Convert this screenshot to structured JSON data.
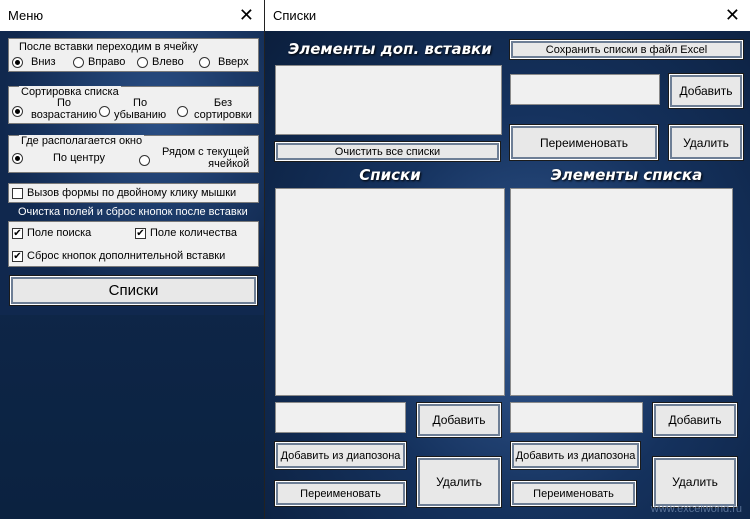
{
  "menu": {
    "title": "Меню",
    "close": "✕",
    "after_insert": {
      "title": "После вставки переходим в ячейку",
      "options": [
        "Вниз",
        "Вправо",
        "Влево",
        "Вверх"
      ],
      "selected": "Вниз"
    },
    "sorting": {
      "title": "Сортировка списка",
      "asc_l1": "По",
      "asc_l2": "возрастанию",
      "desc_l1": "По",
      "desc_l2": "убыванию",
      "none_l1": "Без",
      "none_l2": "сортировки",
      "selected": "asc"
    },
    "position": {
      "title": "Где располагается окно",
      "center": "По центру",
      "near_l1": "Рядом с текущей",
      "near_l2": "ячейкой",
      "selected": "center"
    },
    "double_click": {
      "label": "Вызов формы по двойному клику мышки",
      "checked": false
    },
    "clear_title": "Очистка полей и сброс кнопок после вставки",
    "search_field": {
      "label": "Поле поиска",
      "checked": true
    },
    "qty_field": {
      "label": "Поле количества",
      "checked": true
    },
    "reset_buttons": {
      "label": "Сброс кнопок дополнительной вставки",
      "checked": true
    },
    "lists_button": "Списки"
  },
  "lists": {
    "title": "Списки",
    "close": "✕",
    "extra_heading": "Элементы доп. вставки",
    "save_button": "Сохранить списки в файл Excel",
    "add_button": "Добавить",
    "rename_button": "Переименовать",
    "delete_button": "Удалить",
    "clear_all_button": "Очистить все списки",
    "lists_heading": "Списки",
    "items_heading": "Элементы списка",
    "left": {
      "add": "Добавить",
      "add_range": "Добавить из диапозона",
      "rename": "Переименовать",
      "delete": "Удалить"
    },
    "right": {
      "add": "Добавить",
      "add_range": "Добавить из диапозона",
      "rename": "Переименовать",
      "delete": "Удалить"
    },
    "watermark": "www.excelworld.ru"
  }
}
